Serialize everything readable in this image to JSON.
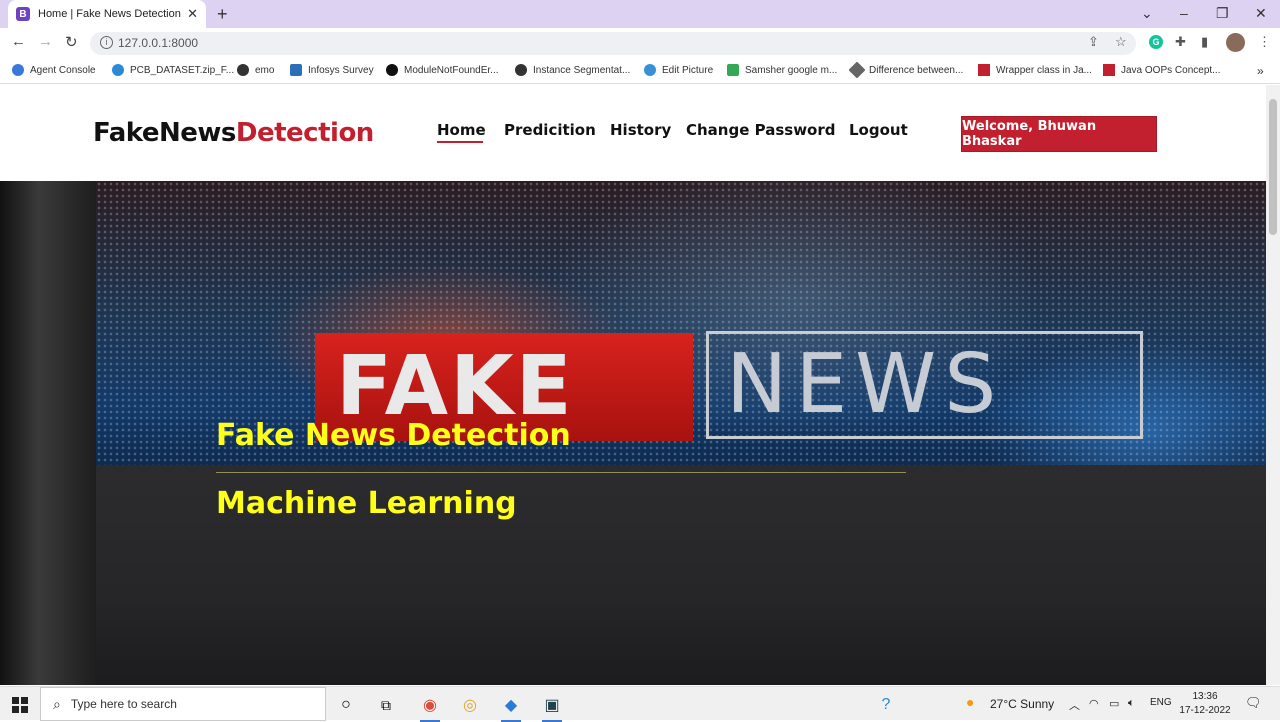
{
  "browser": {
    "tab_title": "Home | Fake News Detection",
    "tab_favicon_letter": "B",
    "url": "127.0.0.1:8000",
    "bookmarks": [
      {
        "label": "Agent Console",
        "color": "#3a78d8"
      },
      {
        "label": "PCB_DATASET.zip_F...",
        "color": "#2a8ad8"
      },
      {
        "label": "emo",
        "color": "#333333"
      },
      {
        "label": "Infosys Survey",
        "color": "#2a6fb8"
      },
      {
        "label": "ModuleNotFoundEr...",
        "color": "#111111"
      },
      {
        "label": "Instance Segmentat...",
        "color": "#333333"
      },
      {
        "label": "Edit Picture",
        "color": "#3a90d8"
      },
      {
        "label": "Samsher google m...",
        "color": "#34a853"
      },
      {
        "label": "Difference between...",
        "color": "#666666"
      },
      {
        "label": "Wrapper class in Ja...",
        "color": "#c3202f"
      },
      {
        "label": "Java OOPs Concept...",
        "color": "#c3202f"
      }
    ]
  },
  "site": {
    "logo_main": "FakeNews",
    "logo_accent": "Detection",
    "nav": [
      "Home",
      "Predicition",
      "History",
      "Change Password",
      "Logout"
    ],
    "active_nav": "Home",
    "welcome_button": "Welcome, Bhuwan Bhaskar",
    "accent_color": "#c3202f"
  },
  "hero": {
    "title": "Fake News Detection",
    "subtitle": "Machine Learning",
    "banner_fake": "FAKE",
    "banner_news": "NEWS",
    "text_color": "#ffff1a"
  },
  "taskbar": {
    "search_placeholder": "Type here to search",
    "weather": "27°C  Sunny",
    "language": "ENG",
    "time": "13:36",
    "date": "17-12-2022"
  }
}
